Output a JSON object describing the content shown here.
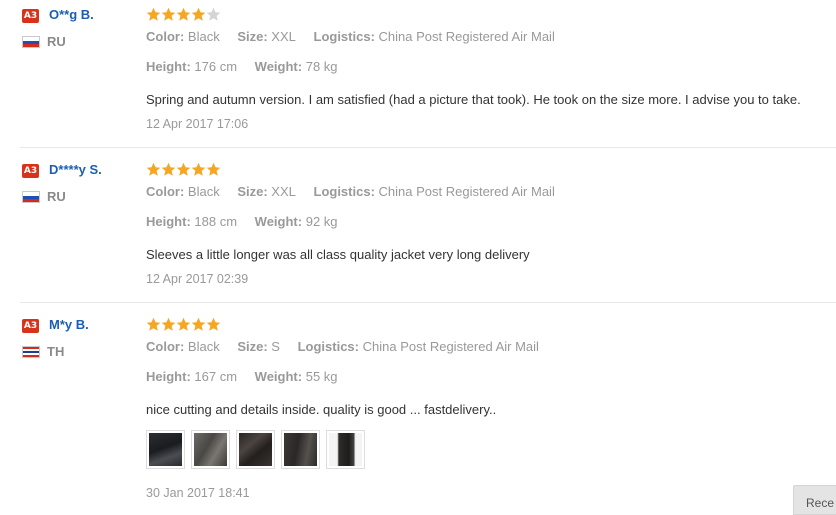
{
  "reviews": [
    {
      "badge": "A3",
      "name": "O**g B.",
      "country": "RU",
      "rating": 4,
      "color_label": "Color:",
      "color": "Black",
      "size_label": "Size:",
      "size": "XXL",
      "logistics_label": "Logistics:",
      "logistics": "China Post Registered Air Mail",
      "height_label": "Height:",
      "height": "176 cm",
      "weight_label": "Weight:",
      "weight": "78 kg",
      "text": "Spring and autumn version. I am satisfied (had a picture that took). He took on the size more. I advise you to take.",
      "date": "12 Apr 2017 17:06"
    },
    {
      "badge": "A3",
      "name": "D****y S.",
      "country": "RU",
      "rating": 5,
      "color_label": "Color:",
      "color": "Black",
      "size_label": "Size:",
      "size": "XXL",
      "logistics_label": "Logistics:",
      "logistics": "China Post Registered Air Mail",
      "height_label": "Height:",
      "height": "188 cm",
      "weight_label": "Weight:",
      "weight": "92 kg",
      "text": "Sleeves a little longer was all class quality jacket very long delivery",
      "date": "12 Apr 2017 02:39"
    },
    {
      "badge": "A3",
      "name": "M*y B.",
      "country": "TH",
      "rating": 5,
      "color_label": "Color:",
      "color": "Black",
      "size_label": "Size:",
      "size": "S",
      "logistics_label": "Logistics:",
      "logistics": "China Post Registered Air Mail",
      "height_label": "Height:",
      "height": "167 cm",
      "weight_label": "Weight:",
      "weight": "55 kg",
      "text": "nice cutting and details inside. quality is good ... fastdelivery..",
      "date": "30 Jan 2017 18:41"
    }
  ],
  "colors": {
    "star_filled": "#f5a623",
    "star_empty": "#d4d4d4",
    "name": "#1a5fb4",
    "badge": "#d8321a"
  },
  "recent_button": "Rece"
}
